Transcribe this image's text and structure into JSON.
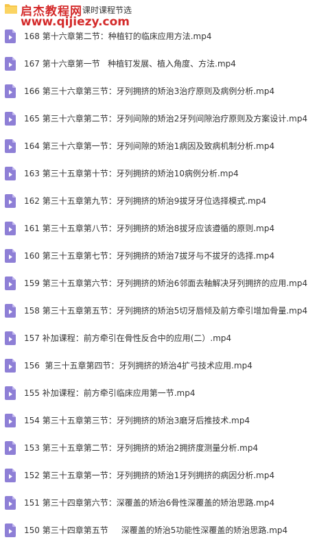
{
  "header": {
    "folder_icon": "folder-icon",
    "title": "课时课程节选",
    "watermark": {
      "site_name": "启杰教程网",
      "url": "www.qijiezy.com",
      "color": "#d42a2a"
    }
  },
  "colors": {
    "folder": "#f7c64a",
    "file_icon": "#8e7fd6",
    "text": "#333333"
  },
  "files": [
    {
      "name": "168 第十六章第二节：种植钉的临床应用方法.mp4",
      "icon": "video-file-icon"
    },
    {
      "name": "167 第十六章第一节   种植钉发展、植入角度、方法.mp4",
      "icon": "video-file-icon"
    },
    {
      "name": "166 第三十六章第三节：牙列拥挤的矫治3治疗原则及病例分析.mp4",
      "icon": "video-file-icon"
    },
    {
      "name": "165 第三十六章第二节：牙列间隙的矫治2牙列间隙治疗原则及方案设计.mp4",
      "icon": "video-file-icon"
    },
    {
      "name": "164 第三十六章第一节：牙列间隙的矫治1病因及致病机制分析.mp4",
      "icon": "video-file-icon"
    },
    {
      "name": "163 第三十五章第十节：牙列拥挤的矫治10病例分析.mp4",
      "icon": "video-file-icon"
    },
    {
      "name": "162 第三十五章第九节：牙列拥挤的矫治9拔牙牙位选择模式.mp4",
      "icon": "video-file-icon"
    },
    {
      "name": "161 第三十五章第八节：牙列拥挤的矫治8拔牙应该遵循的原则.mp4",
      "icon": "video-file-icon"
    },
    {
      "name": "160 第三十五章第七节：牙列拥挤的矫治7拔牙与不拔牙的选择.mp4",
      "icon": "video-file-icon"
    },
    {
      "name": "159 第三十五章第六节：牙列拥挤的矫治6邻面去釉解决牙列拥挤的应用.mp4",
      "icon": "video-file-icon"
    },
    {
      "name": "158 第三十五章第五节：牙列拥挤的矫治5切牙唇倾及前方牵引增加骨量.mp4",
      "icon": "video-file-icon"
    },
    {
      "name": "157 补加课程：前方牵引在骨性反合中的应用(二）.mp4",
      "icon": "video-file-icon"
    },
    {
      "name": "156  第三十五章第四节：牙列拥挤的矫治4扩弓技术应用.mp4",
      "icon": "video-file-icon"
    },
    {
      "name": "155 补加课程：前方牵引临床应用第一节.mp4",
      "icon": "video-file-icon"
    },
    {
      "name": "154 第三十五章第三节：牙列拥挤的矫治3磨牙后推技术.mp4",
      "icon": "video-file-icon"
    },
    {
      "name": "153 第三十五章第二节：牙列拥挤的矫治2拥挤度测量分析.mp4",
      "icon": "video-file-icon"
    },
    {
      "name": "152 第三十五章第一节：牙列拥挤的矫治1牙列拥挤的病因分析.mp4",
      "icon": "video-file-icon"
    },
    {
      "name": "151 第三十四章第六节：深覆盖的矫治6骨性深覆盖的矫治思路.mp4",
      "icon": "video-file-icon"
    },
    {
      "name": "150 第三十四章第五节     深覆盖的矫治5功能性深覆盖的矫治思路.mp4",
      "icon": "video-file-icon"
    }
  ]
}
